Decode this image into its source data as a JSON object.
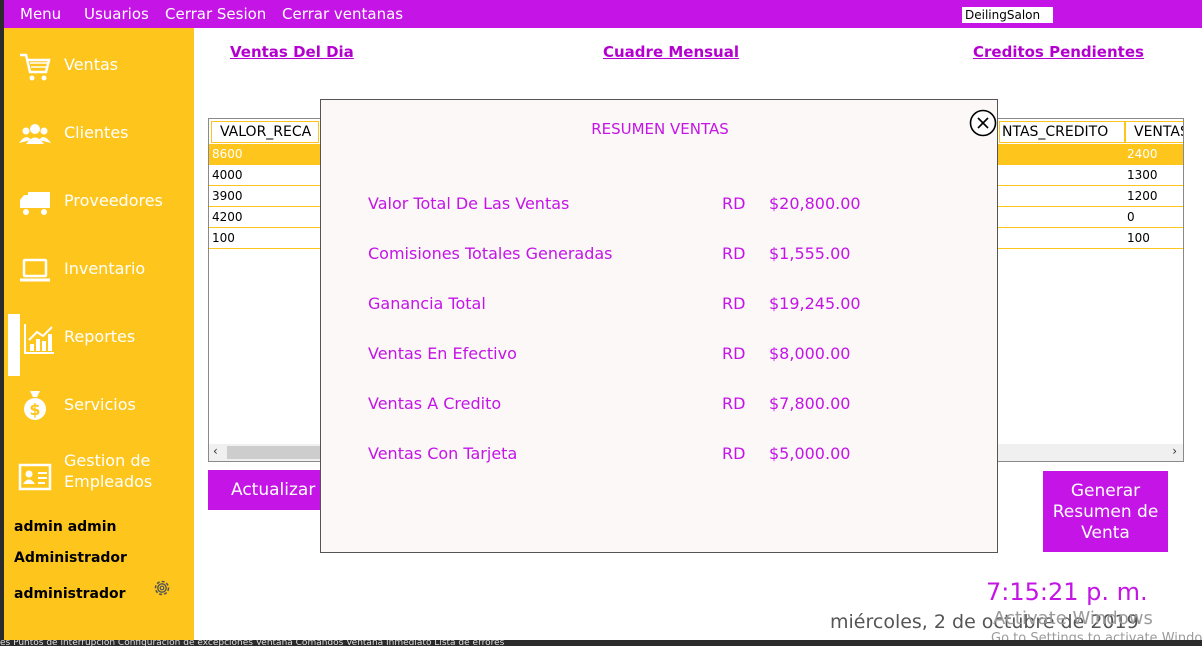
{
  "menubar": {
    "items": [
      "Menu",
      "Usuarios",
      "Cerrar Sesion",
      "Cerrar ventanas"
    ],
    "brand": "DeilingSalon"
  },
  "sidebar": {
    "items": [
      {
        "label": "Ventas",
        "icon": "cart-icon"
      },
      {
        "label": "Clientes",
        "icon": "users-icon"
      },
      {
        "label": "Proveedores",
        "icon": "truck-icon"
      },
      {
        "label": "Inventario",
        "icon": "laptop-icon"
      },
      {
        "label": "Reportes",
        "icon": "chart-icon"
      },
      {
        "label": "Servicios",
        "icon": "money-bag-icon"
      },
      {
        "label": "Gestion de Empleados",
        "icon": "id-card-icon"
      }
    ],
    "user_name": "admin admin",
    "role": "Administrador",
    "username": "administrador"
  },
  "top_links": [
    "Ventas Del Dia",
    "Cuadre Mensual",
    "Creditos Pendientes"
  ],
  "table": {
    "columns": [
      "VALOR_RECA",
      "NTAS_CREDITO",
      "VENTAS"
    ],
    "rows": [
      [
        "8600",
        "",
        "2400"
      ],
      [
        "4000",
        "",
        "1300"
      ],
      [
        "3900",
        "",
        "1200"
      ],
      [
        "4200",
        "",
        "0"
      ],
      [
        "100",
        "",
        "100"
      ]
    ]
  },
  "buttons": {
    "actualizar": "Actualizar",
    "generar": "Generar Resumen de Venta"
  },
  "clock": {
    "time": "7:15:21 p. m.",
    "date": "miércoles, 2 de octubre de 2019"
  },
  "watermark": {
    "line1": "Activate Windows",
    "line2": "Go to Settings to activate Windows."
  },
  "statusbar": "es  Puntos de interrupción  Configuración de excepciones  Ventana Comandos  Ventana Inmediato  Lista de errores",
  "modal": {
    "title": "RESUMEN VENTAS",
    "currency": "RD",
    "rows": [
      {
        "label": "Valor Total De Las Ventas",
        "value": "$20,800.00"
      },
      {
        "label": "Comisiones Totales Generadas",
        "value": "$1,555.00"
      },
      {
        "label": "Ganancia Total",
        "value": "$19,245.00"
      },
      {
        "label": "Ventas En Efectivo",
        "value": "$8,000.00"
      },
      {
        "label": "Ventas A Credito",
        "value": "$7,800.00"
      },
      {
        "label": "Ventas Con Tarjeta",
        "value": "$5,000.00"
      }
    ]
  },
  "colors": {
    "purple": "#c414e6",
    "yellow": "#fec61c"
  }
}
